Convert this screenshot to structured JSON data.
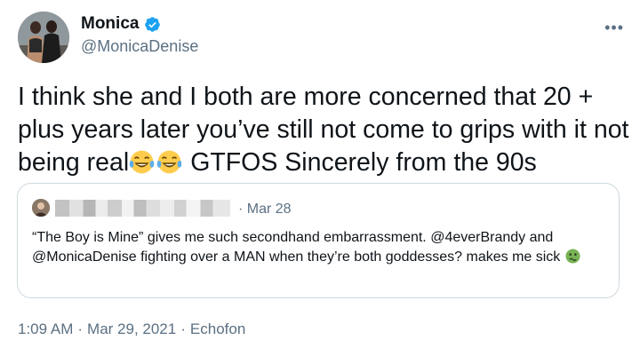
{
  "author": {
    "display_name": "Monica",
    "handle": "@MonicaDenise",
    "verified": true
  },
  "more_icon": "more-horizontal-icon",
  "tweet": {
    "text_line1": "I think she and I both are more concerned that 20 +",
    "text_line2": "plus years later you’ve still not come to grips with it not",
    "text_line3_start": "being real",
    "emojis": [
      "face-with-tears-of-joy",
      "face-with-tears-of-joy"
    ],
    "text_line3_end": "GTFOS Sincerely from the 90s"
  },
  "quoted_tweet": {
    "separator": "·",
    "date": "Mar 28",
    "text": "“The Boy is Mine” gives me such secondhand embarrassment. @4everBrandy and @MonicaDenise fighting over a MAN when they’re both goddesses? makes me sick",
    "emoji": "nauseated-face"
  },
  "meta": {
    "time": "1:09 AM",
    "separator": "·",
    "date": "Mar 29, 2021",
    "source": "Echofon"
  },
  "colors": {
    "verified_blue": "#1da1f2",
    "secondary_text": "#5b7083",
    "border": "#cfd9de"
  }
}
